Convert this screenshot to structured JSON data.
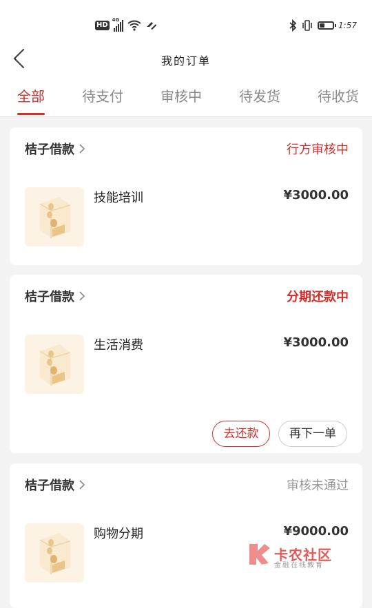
{
  "status_bar": {
    "hd": "HD",
    "network": "4G",
    "time": "1:57",
    "battery_level": 0.4
  },
  "nav": {
    "title": "我的订单"
  },
  "tabs": [
    {
      "label": "全部",
      "active": true
    },
    {
      "label": "待支付",
      "active": false
    },
    {
      "label": "审核中",
      "active": false
    },
    {
      "label": "待发货",
      "active": false
    },
    {
      "label": "待收货",
      "active": false
    }
  ],
  "orders": [
    {
      "shop": "桔子借款",
      "status": "行方审核中",
      "item": "技能培训",
      "price": "¥3000.00"
    },
    {
      "shop": "桔子借款",
      "status": "分期还款中",
      "item": "生活消费",
      "price": "¥3000.00",
      "buttons": {
        "repay": "去还款",
        "again": "再下一单"
      }
    },
    {
      "shop": "桔子借款",
      "status": "审核未通过",
      "item": "购物分期",
      "price": "¥9000.00"
    }
  ],
  "watermark": {
    "text": "卡农社区",
    "sub": "金融在线教育"
  },
  "colors": {
    "accent": "#c8322e",
    "status_red": "#d0302c",
    "status_grey": "#999999",
    "thumb_bg": "#fdf3e4"
  }
}
